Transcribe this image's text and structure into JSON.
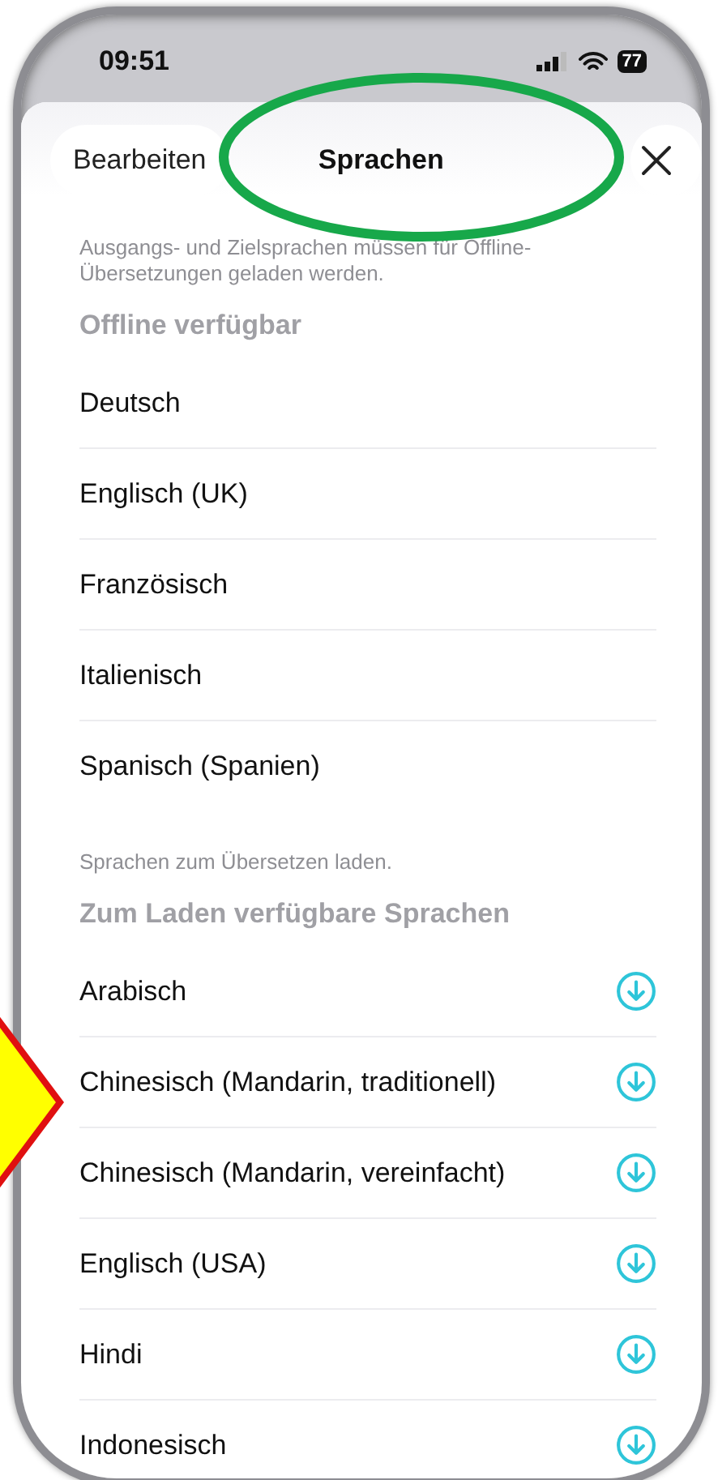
{
  "status_bar": {
    "time": "09:51",
    "battery": "77"
  },
  "header": {
    "edit_button": "Bearbeiten",
    "title": "Sprachen"
  },
  "sections": [
    {
      "note": "Ausgangs- und Zielsprachen müssen für Offline-Übersetzungen geladen werden.",
      "title": "Offline verfügbar",
      "items": [
        {
          "label": "Deutsch",
          "kind": "plain"
        },
        {
          "label": "Englisch (UK)",
          "kind": "plain"
        },
        {
          "label": "Französisch",
          "kind": "plain"
        },
        {
          "label": "Italienisch",
          "kind": "plain"
        },
        {
          "label": "Spanisch (Spanien)",
          "kind": "plain"
        }
      ]
    },
    {
      "note": "Sprachen zum Übersetzen laden.",
      "title": "Zum Laden verfügbare Sprachen",
      "items": [
        {
          "label": "Arabisch",
          "kind": "download"
        },
        {
          "label": "Chinesisch (Mandarin, traditionell)",
          "kind": "download"
        },
        {
          "label": "Chinesisch (Mandarin, vereinfacht)",
          "kind": "download"
        },
        {
          "label": "Englisch (USA)",
          "kind": "download"
        },
        {
          "label": "Hindi",
          "kind": "download"
        },
        {
          "label": "Indonesisch",
          "kind": "download"
        }
      ]
    }
  ]
}
